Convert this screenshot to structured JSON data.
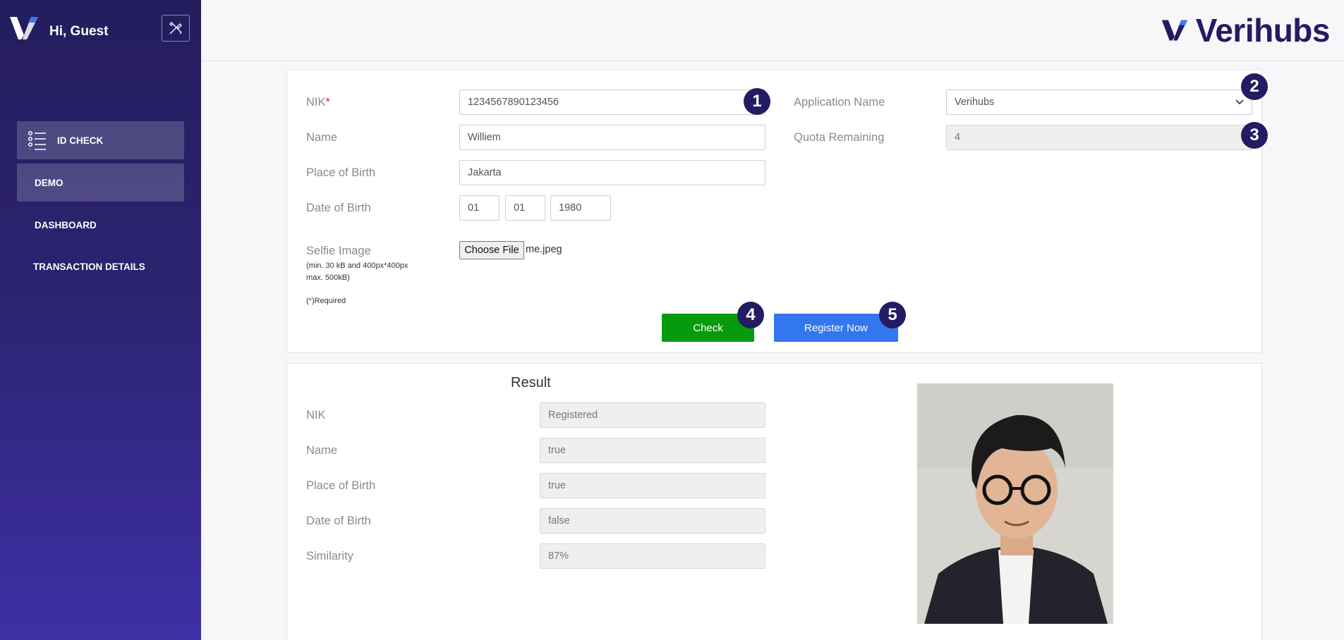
{
  "sidebar": {
    "greeting": "Hi, Guest",
    "items": [
      {
        "label": "ID CHECK",
        "icon": "list-icon"
      },
      {
        "label": "DEMO"
      },
      {
        "label": "DASHBOARD"
      },
      {
        "label": "TRANSACTION DETAILS"
      }
    ]
  },
  "brand": {
    "name": "Verihubs"
  },
  "form": {
    "nik_label": "NIK",
    "nik_value": "1234567890123456",
    "name_label": "Name",
    "name_value": "Williem",
    "pob_label": "Place of Birth",
    "pob_value": "Jakarta",
    "dob_label": "Date of Birth",
    "dob_day": "01",
    "dob_month": "01",
    "dob_year": "1980",
    "selfie_label": "Selfie Image",
    "selfie_note_1": "(min. 30 kB and 400px*400px",
    "selfie_note_2": "max. 500kB)",
    "choose_file": "Choose File",
    "file_name": "me.jpeg",
    "required_open": "(",
    "required_star": "*",
    "required_text": ")Required",
    "app_name_label": "Application Name",
    "app_name_value": "Verihubs",
    "quota_label": "Quota Remaining",
    "quota_value": "4",
    "check_label": "Check",
    "register_label": "Register Now",
    "badges": [
      "1",
      "2",
      "3",
      "4",
      "5"
    ]
  },
  "result": {
    "title": "Result",
    "rows": [
      {
        "label": "NIK",
        "value": "Registered"
      },
      {
        "label": "Name",
        "value": "true"
      },
      {
        "label": "Place of Birth",
        "value": "true"
      },
      {
        "label": "Date of Birth",
        "value": "false"
      },
      {
        "label": "Similarity",
        "value": "87%"
      }
    ]
  },
  "colors": {
    "sidebar_top": "#241d5c",
    "sidebar_bottom": "#3f2fa6",
    "brand": "#231c63",
    "check": "#069b0e",
    "register": "#3276f0"
  }
}
